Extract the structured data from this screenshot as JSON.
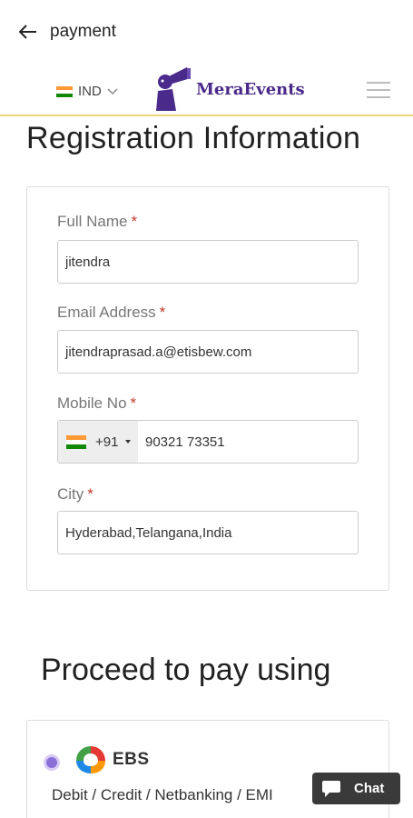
{
  "appbar": {
    "title": "payment"
  },
  "header": {
    "country_code": "IND",
    "logo_text": "MeraEvents",
    "flag_colors": [
      "#ff9933",
      "#ffffff",
      "#138808"
    ]
  },
  "registration": {
    "title": "Registration Information",
    "required_mark": "*",
    "fields": [
      {
        "label": "Full Name",
        "value": "jitendra"
      },
      {
        "label": "Email Address",
        "value": "jitendraprasad.a@etisbew.com"
      },
      {
        "label": "Mobile No",
        "dial_code": "+91",
        "value": "90321 73351"
      },
      {
        "label": "City",
        "value": "Hyderabad,Telangana,India"
      }
    ]
  },
  "payment": {
    "title": "Proceed to pay using",
    "method": {
      "name": "EBS",
      "description": "Debit / Credit / Netbanking / EMI",
      "selected": true
    }
  },
  "chat": {
    "label": "Chat"
  },
  "colors": {
    "accent": "#8b6fd8",
    "header_border": "#f0d67a",
    "required": "#c0392b"
  }
}
